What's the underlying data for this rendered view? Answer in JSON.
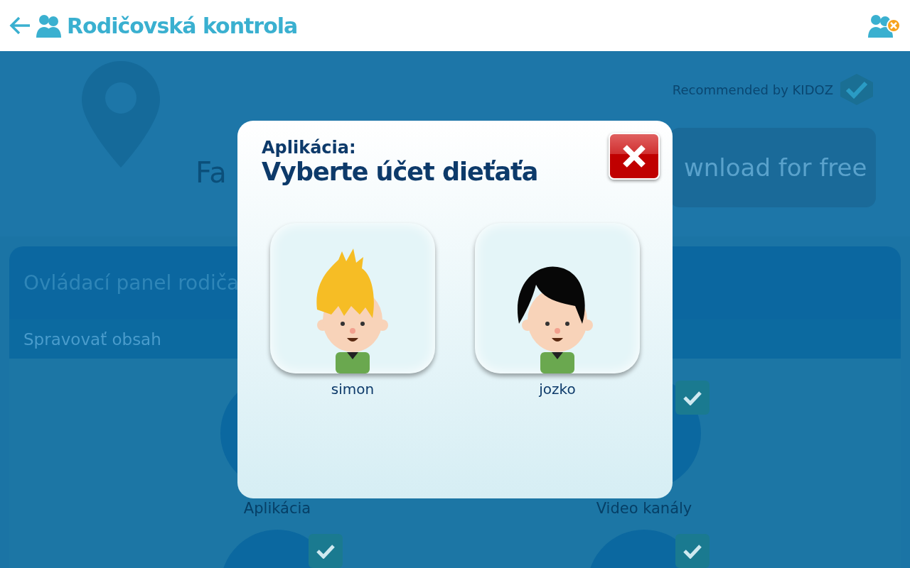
{
  "header": {
    "title": "Rodičovská kontrola"
  },
  "banner": {
    "logo_subtitle": "Fa",
    "recommended": "Recommended by KIDOZ",
    "download_button": "wnload for free"
  },
  "panel": {
    "title": "Ovládací panel rodiča",
    "section": "Spravovať obsah",
    "items": [
      {
        "label": "Aplikácia"
      },
      {
        "label": "Video kanály",
        "checked": true
      },
      {
        "checked": true
      },
      {
        "checked": true
      }
    ]
  },
  "dialog": {
    "subtitle": "Aplikácia:",
    "title": "Vyberte účet dieťaťa",
    "children": [
      {
        "name": "simon",
        "kind": "blond"
      },
      {
        "name": "jozko",
        "kind": "dark"
      }
    ]
  }
}
